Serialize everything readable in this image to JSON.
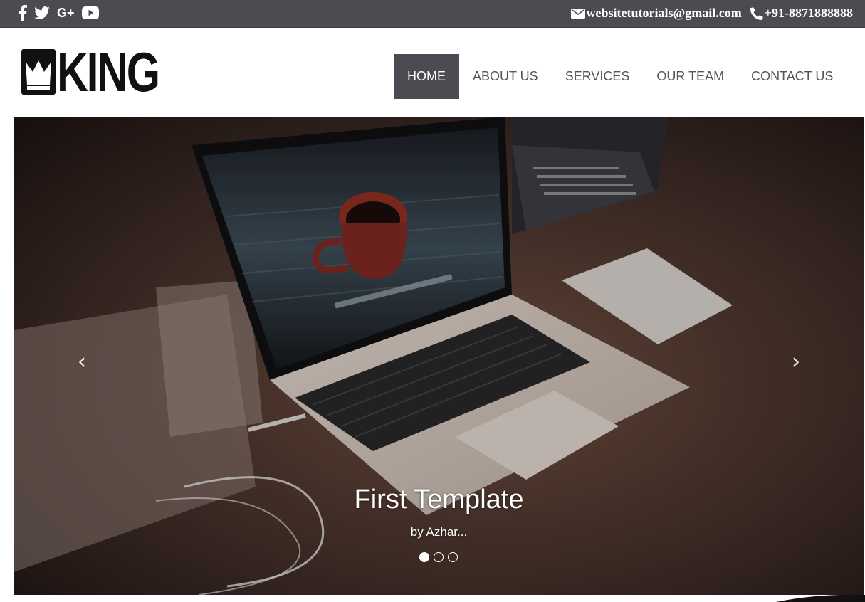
{
  "topbar": {
    "social": [
      {
        "name": "facebook",
        "icon": "facebook-icon"
      },
      {
        "name": "twitter",
        "icon": "twitter-icon"
      },
      {
        "name": "google-plus",
        "icon": "google-plus-icon",
        "glyph": "G+"
      },
      {
        "name": "youtube",
        "icon": "youtube-icon"
      }
    ],
    "email": "websitetutorials@gmail.com",
    "phone": "+91-8871888888",
    "bg_color": "#4a4c52"
  },
  "header": {
    "logo_text": "KING",
    "nav": [
      {
        "label": "HOME",
        "active": true
      },
      {
        "label": "ABOUT US",
        "active": false
      },
      {
        "label": "SERVICES",
        "active": false
      },
      {
        "label": "OUR TEAM",
        "active": false
      },
      {
        "label": "CONTACT US",
        "active": false
      }
    ]
  },
  "hero": {
    "title": "First Template",
    "subtitle": "by Azhar...",
    "prev_glyph": "‹",
    "next_glyph": "›",
    "slides": 3,
    "active_slide": 1
  }
}
